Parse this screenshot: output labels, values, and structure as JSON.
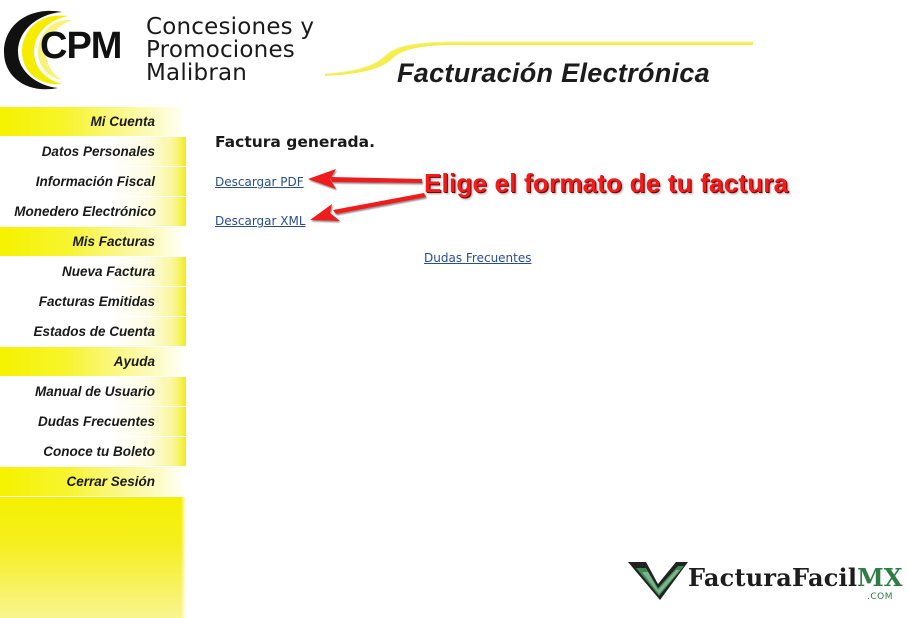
{
  "logo": {
    "mark_text": "CPM",
    "lines": [
      "Concesiones y",
      "Promociones",
      "Malibran"
    ]
  },
  "header": {
    "title": "Facturación Electrónica"
  },
  "sidebar": {
    "items": [
      {
        "label": "Mi Cuenta",
        "kind": "section"
      },
      {
        "label": "Datos Personales",
        "kind": "link"
      },
      {
        "label": "Información Fiscal",
        "kind": "link"
      },
      {
        "label": "Monedero Electrónico",
        "kind": "link"
      },
      {
        "label": "Mis Facturas",
        "kind": "section"
      },
      {
        "label": "Nueva Factura",
        "kind": "link"
      },
      {
        "label": "Facturas Emitidas",
        "kind": "link"
      },
      {
        "label": "Estados de Cuenta",
        "kind": "link"
      },
      {
        "label": "Ayuda",
        "kind": "section"
      },
      {
        "label": "Manual de Usuario",
        "kind": "link"
      },
      {
        "label": "Dudas Frecuentes",
        "kind": "link"
      },
      {
        "label": "Conoce tu Boleto",
        "kind": "link"
      },
      {
        "label": "Cerrar Sesión",
        "kind": "section"
      }
    ]
  },
  "main": {
    "heading": "Factura generada.",
    "download_pdf": "Descargar PDF",
    "download_xml": "Descargar XML",
    "faq_link": "Dudas Frecuentes"
  },
  "annotation": {
    "text": "Elige el formato de tu factura"
  },
  "watermark": {
    "brand": "FacturaFacil",
    "brand_suffix": "MX",
    "domain": ".COM"
  },
  "colors": {
    "brand_yellow": "#f5f000",
    "link_blue": "#2a4f8e",
    "annotation_red": "#ef1c1c",
    "watermark_green": "#2e7d45"
  },
  "icons": {
    "logo": "cpm-crescent-logo",
    "watermark": "check-mark-icon"
  }
}
